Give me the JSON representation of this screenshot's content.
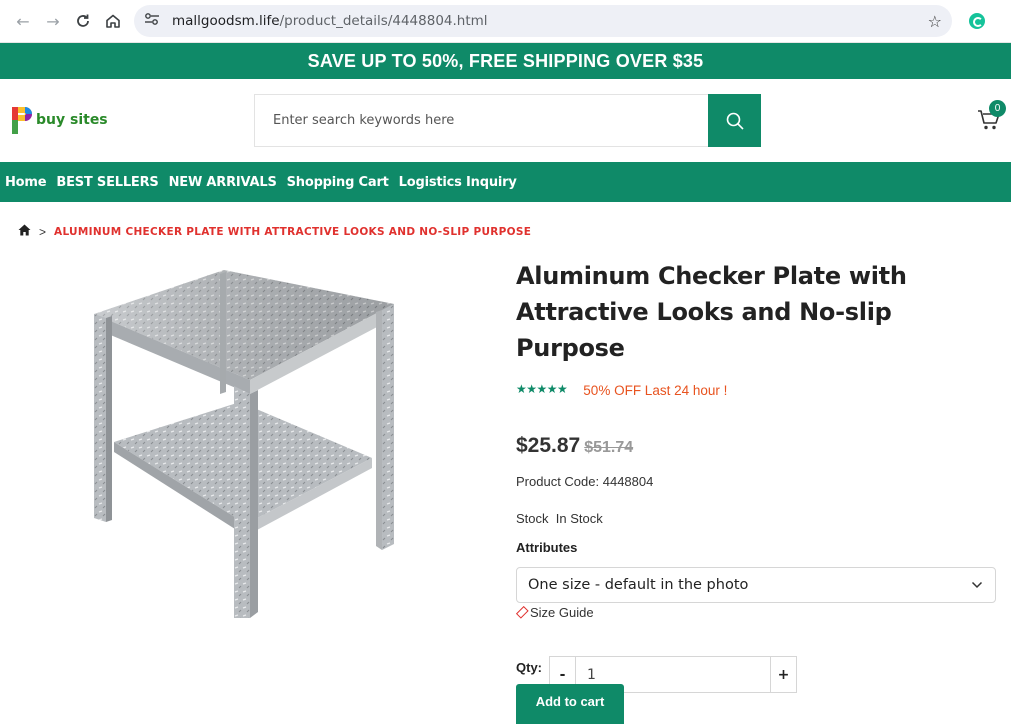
{
  "browser": {
    "url_domain": "mallgoodsm.life",
    "url_path": "/product_details/4448804.html"
  },
  "promo": {
    "text": "SAVE UP TO 50%, FREE SHIPPING OVER $35"
  },
  "header": {
    "logo_text": "buy sites",
    "search_placeholder": "Enter search keywords here",
    "cart_count": "0"
  },
  "nav": {
    "items": [
      "Home",
      "BEST SELLERS",
      "NEW ARRIVALS",
      "Shopping Cart",
      "Logistics Inquiry"
    ]
  },
  "breadcrumb": {
    "separator": ">",
    "current": "ALUMINUM CHECKER PLATE WITH ATTRACTIVE LOOKS AND NO-SLIP PURPOSE"
  },
  "product": {
    "title_line1": "Aluminum Checker Plate with",
    "title_line2": "Attractive Looks and No-slip Purpose",
    "stars": "★★★★★",
    "discount_text": "50% OFF Last 24 hour !",
    "price": "$25.87",
    "original_price": "$51.74",
    "code_label": "Product Code:",
    "code_value": "4448804",
    "stock_label": "Stock",
    "stock_value": "In Stock",
    "attributes_label": "Attributes",
    "attribute_selected": "One size - default in the photo",
    "size_guide": "Size Guide",
    "qty_label": "Qty:",
    "qty_minus": "-",
    "qty_value": "1",
    "qty_plus": "+",
    "add_to_cart": "Add to cart"
  },
  "colors": {
    "brand_green": "#0f8a68",
    "discount_orange": "#e8531f",
    "breadcrumb_red": "#e0312e"
  },
  "icons": [
    "back-arrow-icon",
    "forward-arrow-icon",
    "reload-icon",
    "home-icon",
    "site-settings-icon",
    "bookmark-star-icon",
    "extension-icon",
    "search-icon",
    "cart-icon",
    "breadcrumb-home-icon",
    "chevron-down-icon",
    "size-guide-tag-icon"
  ]
}
